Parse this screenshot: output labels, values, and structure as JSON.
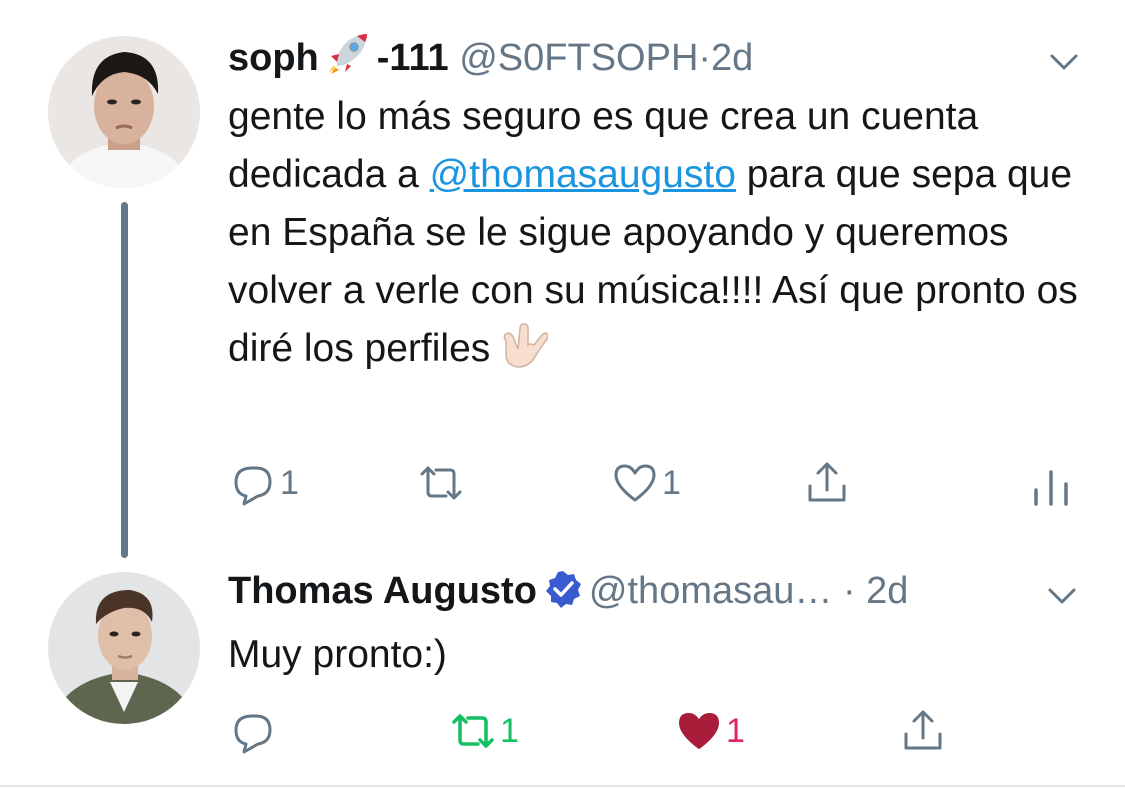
{
  "tweets": [
    {
      "name": "soph",
      "name_suffix": "-111",
      "handle": "@S0FTSOPH",
      "separator": "·",
      "time": "2d",
      "text_before": "gente lo más seguro es que crea un cuenta dedicada a ",
      "mention": "@thomasaugusto",
      "text_after": " para que sepa que en España se le sigue apoyando y queremos volver a verle con su música!!!! Así que pronto os diré los perfiles",
      "emoji_name_icon": "rocket-icon",
      "emoji_end_icon": "love-you-hand-icon",
      "actions": {
        "reply_count": "1",
        "retweet_count": "",
        "like_count": "1"
      }
    },
    {
      "name": "Thomas Augusto",
      "handle": "@thomasau…",
      "separator": "·",
      "time": "2d",
      "text": "Muy pronto:)",
      "verified_icon": "verified-badge-icon",
      "actions": {
        "reply_count": "",
        "retweet_count": "1",
        "like_count": "1",
        "retweeted": true,
        "liked": true
      }
    }
  ],
  "colors": {
    "text": "#14171a",
    "secondary": "#657786",
    "link": "#1b95e0",
    "retweet_active": "#17bf63",
    "like_active": "#e0245e",
    "verified": "#1da1f2"
  }
}
